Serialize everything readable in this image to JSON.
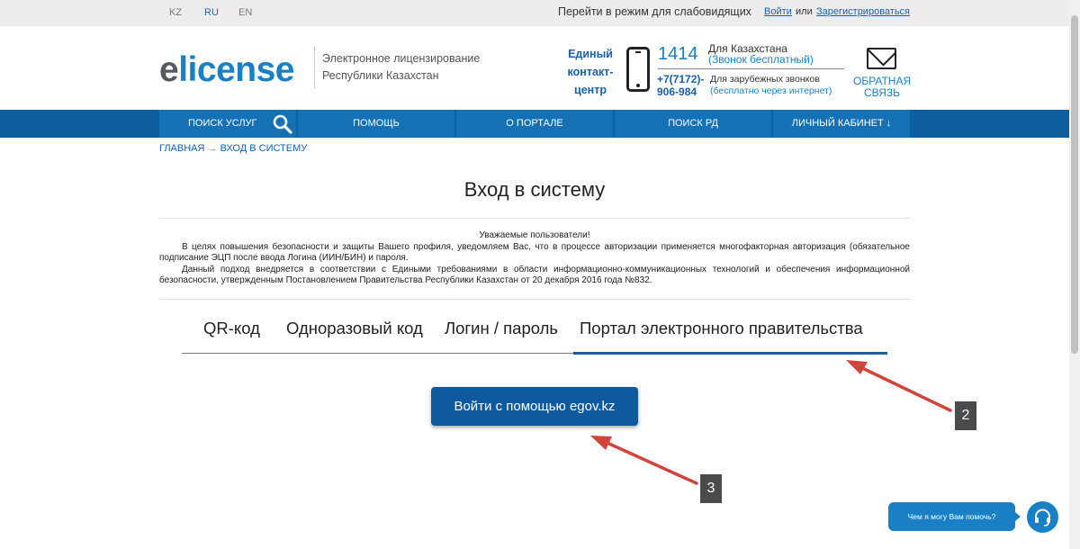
{
  "topbar": {
    "languages": [
      "KZ",
      "RU",
      "EN"
    ],
    "low_vision": "Перейти в режим для слабовидящих",
    "login": "Войти",
    "or": "или",
    "register": "Зарегистрироваться"
  },
  "header": {
    "logo_e": "e",
    "logo_rest": "license",
    "tagline_1": "Электронное лицензирование",
    "tagline_2": "Республики Казахстан",
    "contact_title_1": "Единый",
    "contact_title_2": "контакт-",
    "contact_title_3": "центр",
    "phone_short": "1414",
    "phone_short_label": "Для Казахстана",
    "phone_short_note": "(Звонок бесплатный)",
    "phone_intl_1": "+7(7172)-",
    "phone_intl_2": "906-984",
    "phone_intl_label": "Для зарубежных звонков",
    "phone_intl_note": "(бесплатно через интернет)",
    "feedback_1": "ОБРАТНАЯ",
    "feedback_2": "СВЯЗЬ"
  },
  "nav": {
    "items": [
      "ПОИСК УСЛУГ",
      "ПОМОЩЬ",
      "О ПОРТАЛЕ",
      "ПОИСК РД",
      "ЛИЧНЫЙ КАБИНЕТ ↓"
    ]
  },
  "breadcrumb": {
    "home": "ГЛАВНАЯ",
    "separator": "→",
    "current": "ВХОД В СИСТЕМУ"
  },
  "main": {
    "title": "Вход в систему",
    "notice_greeting": "Уважаемые пользователи!",
    "notice_p1": "В целях повышения безопасности и защиты Вашего профиля, уведомляем Вас, что в процессе авторизации применяется многофакторная авторизация (обязательное подписание ЭЦП после ввода Логина (ИИН/БИН) и пароля.",
    "notice_p2": "Данный подход внедряется в соответствии с Едиными требованиями в области информационно-коммуникационных технологий и обеспечения информационной безопасности, утвержденным Постановлением Правительства Республики Казахстан от 20 декабря 2016 года №832.",
    "tabs": [
      "QR-код",
      "Одноразовый код",
      "Логин / пароль",
      "Портал электронного правительства"
    ],
    "active_tab": 3,
    "egov_button": "Войти с помощью egov.kz"
  },
  "annotations": {
    "marker_2": "2",
    "marker_3": "3",
    "arrow_color": "#d0453b"
  },
  "chat": {
    "prompt": "Чем я могу Вам помочь?"
  },
  "colors": {
    "nav_bar": "#0e5f9f",
    "nav_item": "#1670b4",
    "brand": "#1a80c6",
    "button": "#0f5a9e"
  }
}
